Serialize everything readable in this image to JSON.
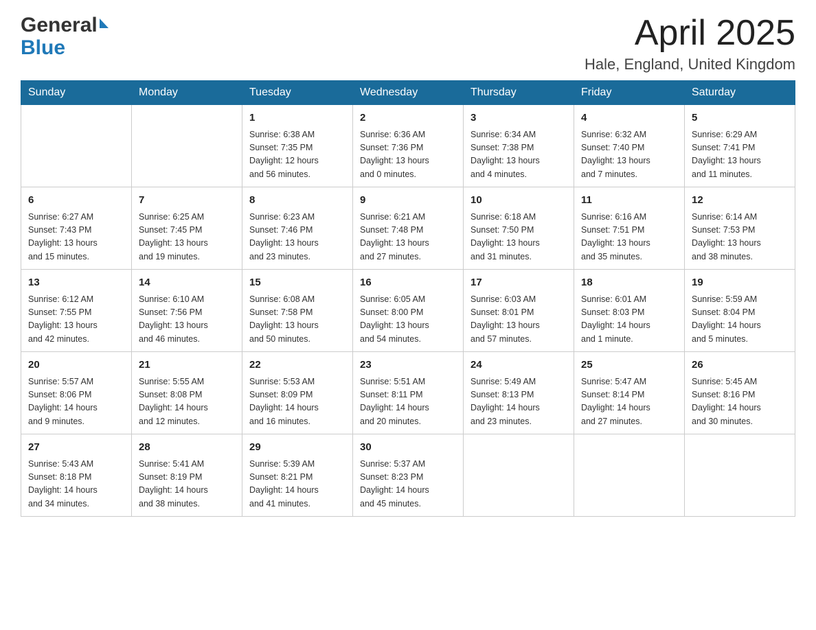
{
  "header": {
    "logo_general": "General",
    "logo_blue": "Blue",
    "month_title": "April 2025",
    "location": "Hale, England, United Kingdom"
  },
  "days_of_week": [
    "Sunday",
    "Monday",
    "Tuesday",
    "Wednesday",
    "Thursday",
    "Friday",
    "Saturday"
  ],
  "weeks": [
    [
      {
        "day": "",
        "info": ""
      },
      {
        "day": "",
        "info": ""
      },
      {
        "day": "1",
        "info": "Sunrise: 6:38 AM\nSunset: 7:35 PM\nDaylight: 12 hours\nand 56 minutes."
      },
      {
        "day": "2",
        "info": "Sunrise: 6:36 AM\nSunset: 7:36 PM\nDaylight: 13 hours\nand 0 minutes."
      },
      {
        "day": "3",
        "info": "Sunrise: 6:34 AM\nSunset: 7:38 PM\nDaylight: 13 hours\nand 4 minutes."
      },
      {
        "day": "4",
        "info": "Sunrise: 6:32 AM\nSunset: 7:40 PM\nDaylight: 13 hours\nand 7 minutes."
      },
      {
        "day": "5",
        "info": "Sunrise: 6:29 AM\nSunset: 7:41 PM\nDaylight: 13 hours\nand 11 minutes."
      }
    ],
    [
      {
        "day": "6",
        "info": "Sunrise: 6:27 AM\nSunset: 7:43 PM\nDaylight: 13 hours\nand 15 minutes."
      },
      {
        "day": "7",
        "info": "Sunrise: 6:25 AM\nSunset: 7:45 PM\nDaylight: 13 hours\nand 19 minutes."
      },
      {
        "day": "8",
        "info": "Sunrise: 6:23 AM\nSunset: 7:46 PM\nDaylight: 13 hours\nand 23 minutes."
      },
      {
        "day": "9",
        "info": "Sunrise: 6:21 AM\nSunset: 7:48 PM\nDaylight: 13 hours\nand 27 minutes."
      },
      {
        "day": "10",
        "info": "Sunrise: 6:18 AM\nSunset: 7:50 PM\nDaylight: 13 hours\nand 31 minutes."
      },
      {
        "day": "11",
        "info": "Sunrise: 6:16 AM\nSunset: 7:51 PM\nDaylight: 13 hours\nand 35 minutes."
      },
      {
        "day": "12",
        "info": "Sunrise: 6:14 AM\nSunset: 7:53 PM\nDaylight: 13 hours\nand 38 minutes."
      }
    ],
    [
      {
        "day": "13",
        "info": "Sunrise: 6:12 AM\nSunset: 7:55 PM\nDaylight: 13 hours\nand 42 minutes."
      },
      {
        "day": "14",
        "info": "Sunrise: 6:10 AM\nSunset: 7:56 PM\nDaylight: 13 hours\nand 46 minutes."
      },
      {
        "day": "15",
        "info": "Sunrise: 6:08 AM\nSunset: 7:58 PM\nDaylight: 13 hours\nand 50 minutes."
      },
      {
        "day": "16",
        "info": "Sunrise: 6:05 AM\nSunset: 8:00 PM\nDaylight: 13 hours\nand 54 minutes."
      },
      {
        "day": "17",
        "info": "Sunrise: 6:03 AM\nSunset: 8:01 PM\nDaylight: 13 hours\nand 57 minutes."
      },
      {
        "day": "18",
        "info": "Sunrise: 6:01 AM\nSunset: 8:03 PM\nDaylight: 14 hours\nand 1 minute."
      },
      {
        "day": "19",
        "info": "Sunrise: 5:59 AM\nSunset: 8:04 PM\nDaylight: 14 hours\nand 5 minutes."
      }
    ],
    [
      {
        "day": "20",
        "info": "Sunrise: 5:57 AM\nSunset: 8:06 PM\nDaylight: 14 hours\nand 9 minutes."
      },
      {
        "day": "21",
        "info": "Sunrise: 5:55 AM\nSunset: 8:08 PM\nDaylight: 14 hours\nand 12 minutes."
      },
      {
        "day": "22",
        "info": "Sunrise: 5:53 AM\nSunset: 8:09 PM\nDaylight: 14 hours\nand 16 minutes."
      },
      {
        "day": "23",
        "info": "Sunrise: 5:51 AM\nSunset: 8:11 PM\nDaylight: 14 hours\nand 20 minutes."
      },
      {
        "day": "24",
        "info": "Sunrise: 5:49 AM\nSunset: 8:13 PM\nDaylight: 14 hours\nand 23 minutes."
      },
      {
        "day": "25",
        "info": "Sunrise: 5:47 AM\nSunset: 8:14 PM\nDaylight: 14 hours\nand 27 minutes."
      },
      {
        "day": "26",
        "info": "Sunrise: 5:45 AM\nSunset: 8:16 PM\nDaylight: 14 hours\nand 30 minutes."
      }
    ],
    [
      {
        "day": "27",
        "info": "Sunrise: 5:43 AM\nSunset: 8:18 PM\nDaylight: 14 hours\nand 34 minutes."
      },
      {
        "day": "28",
        "info": "Sunrise: 5:41 AM\nSunset: 8:19 PM\nDaylight: 14 hours\nand 38 minutes."
      },
      {
        "day": "29",
        "info": "Sunrise: 5:39 AM\nSunset: 8:21 PM\nDaylight: 14 hours\nand 41 minutes."
      },
      {
        "day": "30",
        "info": "Sunrise: 5:37 AM\nSunset: 8:23 PM\nDaylight: 14 hours\nand 45 minutes."
      },
      {
        "day": "",
        "info": ""
      },
      {
        "day": "",
        "info": ""
      },
      {
        "day": "",
        "info": ""
      }
    ]
  ]
}
